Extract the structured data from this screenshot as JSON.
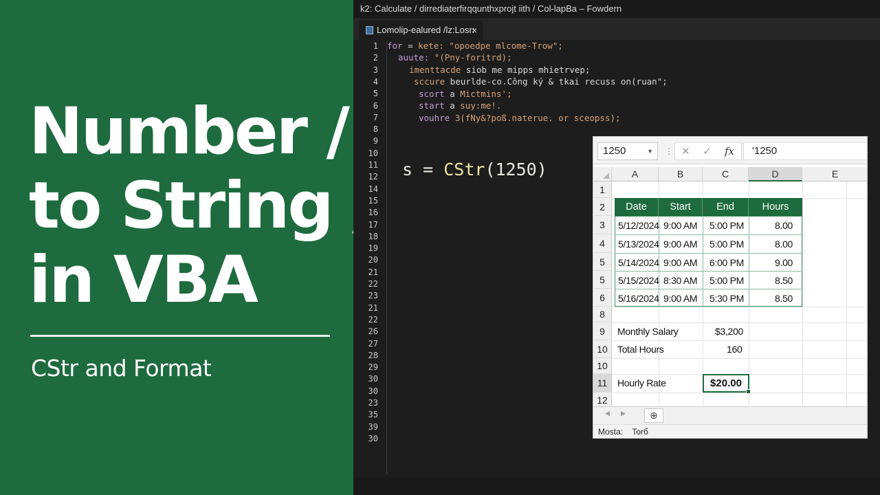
{
  "title_panel": {
    "title_lines": [
      "Number /",
      "to String /",
      "in VBA"
    ],
    "subtitle": "CStr and Format"
  },
  "editor": {
    "window_title": "k2: Calculate / dirrediaterfirqqunthxprojt iith / Col-lapBa – Fowdern",
    "tab": {
      "label": "Lomolip-ealured /lz:Losr:",
      "close": "×"
    },
    "line_numbers": [
      "1",
      "2",
      "3",
      "4",
      "5",
      "6",
      "7",
      "8",
      "9",
      "10",
      "11",
      "12",
      "14",
      "15",
      "16",
      "17",
      "18",
      "19",
      "20",
      "21",
      "22",
      "23",
      "21",
      "22",
      "26",
      "27",
      "28",
      "29",
      "30",
      "30",
      "23",
      "35",
      "39",
      "30"
    ],
    "code_lines": [
      {
        "kw": "for",
        "txt": " = ",
        "str": "kete: \"opoedpe  mlcome-Trow\";"
      },
      {
        "kw": "auute:",
        "txt": " ",
        "str": "°(Pny-foritrd);"
      },
      {
        "kw": "imenttacde",
        "txt": " siob me mipps mhietrvep;",
        "str": ""
      },
      {
        "kw": "sccure",
        "txt": " beurlde-co.Công ký & tkai recuss on(ruan\";",
        "str": ""
      },
      {
        "kw": "scort",
        "txt": " a ",
        "str": "Mictmins';"
      },
      {
        "kw": "start",
        "txt": " a ",
        "str": "suy:me!."
      },
      {
        "kw": "vouhre",
        "txt": " ",
        "str": "3(fNy&?poß.naterue. or sceopss);"
      }
    ],
    "highlight_code": {
      "var": "s = ",
      "fn": "CStr",
      "args": "(1250)"
    }
  },
  "spreadsheet": {
    "name_box": "1250",
    "fx_label": "fx",
    "formula_value": "'1250",
    "columns": [
      "A",
      "B",
      "C",
      "D",
      "E"
    ],
    "rows": [
      "1",
      "2",
      "3",
      "4",
      "5",
      "5",
      "6",
      "8",
      "9",
      "10",
      "10",
      "11",
      "12"
    ],
    "table": {
      "headers": [
        "Date",
        "Start",
        "End",
        "Hours"
      ],
      "rows": [
        [
          "5/12/2024",
          "9:00 AM",
          "5:00 PM",
          "8.00"
        ],
        [
          "5/13/2024",
          "9:00 AM",
          "5:00 PM",
          "8.00"
        ],
        [
          "5/14/2024",
          "9:00 AM",
          "6:00 PM",
          "9.00"
        ],
        [
          "5/15/2024",
          "8:30 AM",
          "5:00 PM",
          "8.50"
        ],
        [
          "5/16/2024",
          "9:00 AM",
          "5:30 PM",
          "8.50"
        ]
      ]
    },
    "summary": {
      "monthly_salary_label": "Monthly Salary",
      "monthly_salary_value": "$3,200",
      "total_hours_label": "Total Hours",
      "total_hours_value": "160",
      "hourly_rate_label": "Hourly Rate",
      "hourly_rate_value": "$20.00"
    },
    "status": {
      "label": "Mosta:",
      "mode": "Torб"
    },
    "add_sheet_icon": "⊕"
  }
}
